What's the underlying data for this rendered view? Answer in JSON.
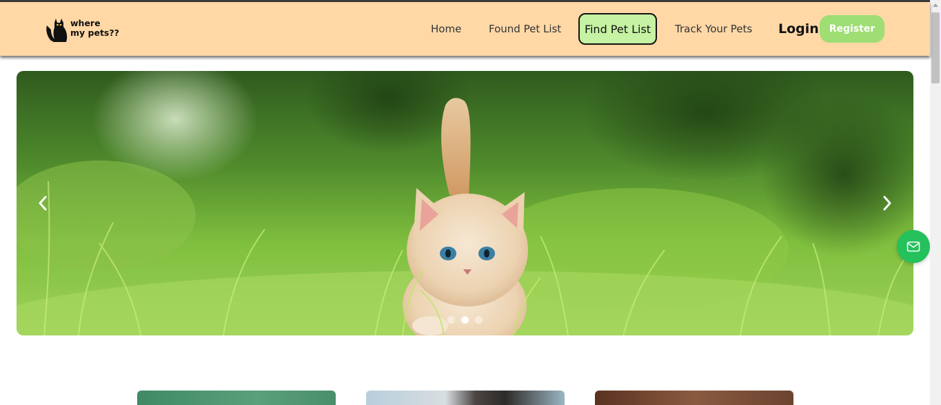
{
  "brand": {
    "logo_line1": "where",
    "logo_line2": "my pets??",
    "logo_icon": "black-cat-icon"
  },
  "nav": {
    "items": [
      {
        "label": "Home",
        "active": false
      },
      {
        "label": "Found Pet List",
        "active": false
      },
      {
        "label": "Find Pet List",
        "active": true
      },
      {
        "label": "Track Your Pets",
        "active": false
      }
    ],
    "login_label": "Login",
    "register_label": "Register"
  },
  "hero": {
    "image_subject": "kitten-in-grass",
    "slide_count": 3,
    "active_slide": 2,
    "prev_icon": "chevron-left-icon",
    "next_icon": "chevron-right-icon"
  },
  "contact_fab": {
    "icon": "mail-icon"
  },
  "cards": [
    {
      "image": "card-image-1"
    },
    {
      "image": "card-image-2"
    },
    {
      "image": "card-image-3"
    }
  ],
  "colors": {
    "navbar_bg": "#ffd8a6",
    "active_nav_bg": "#c5f2a3",
    "register_bg": "#9ede73",
    "fab_bg": "#25c15c"
  }
}
